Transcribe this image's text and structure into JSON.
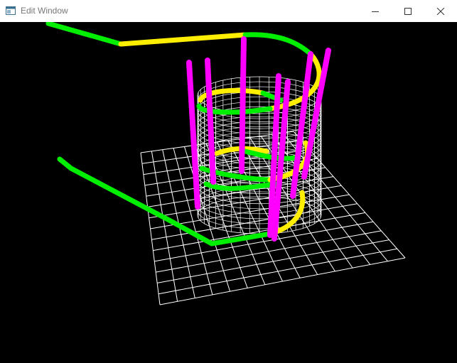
{
  "window": {
    "title": "Edit Window",
    "icon": "app-window-icon",
    "controls": [
      {
        "name": "minimize-icon"
      },
      {
        "name": "maximize-icon"
      },
      {
        "name": "close-icon"
      }
    ]
  },
  "scene": {
    "background": "#000000",
    "colors": {
      "grid": "#ffffff",
      "track_green": "#00ee00",
      "track_yellow": "#ffee00",
      "pillar": "#ff00ff",
      "wireframe": "#ffffff"
    }
  }
}
